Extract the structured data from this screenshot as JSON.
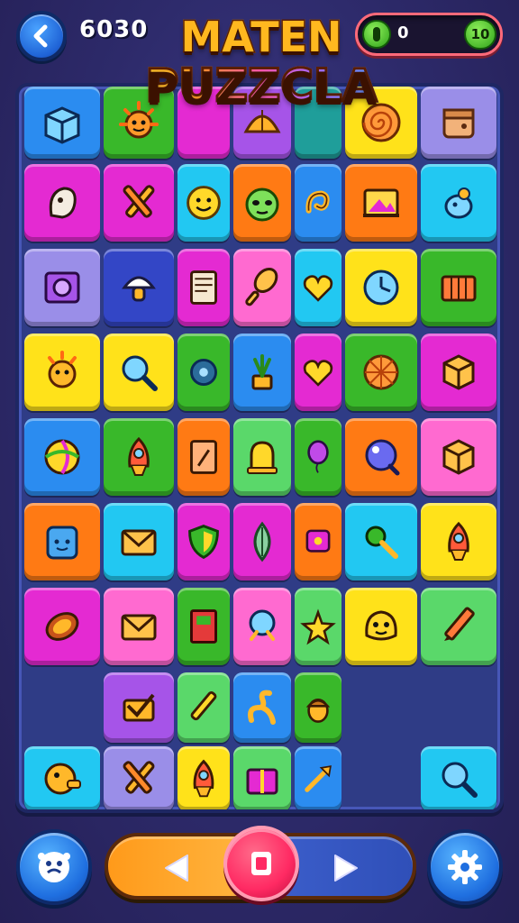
{
  "header": {
    "score": "6030",
    "title_line1": "MATEN",
    "title_line2": "PUZZCLA",
    "progress_current": "0",
    "progress_max": "10",
    "progress_fraction": 0
  },
  "colors": {
    "yellow": "#ffe21a",
    "cyan": "#22c8f2",
    "magenta": "#e42ad2",
    "purple": "#a654e8",
    "green": "#39b82a",
    "lime": "#5ad86a",
    "orange": "#ff7a14",
    "pink": "#ff6ad0",
    "blue": "#2b8cf0",
    "navy": "#3346c6",
    "teal": "#1f9e9a",
    "lavender": "#9a8ee8",
    "red": "#ef4a20"
  },
  "board": {
    "rows": [
      [
        {
          "icon": "cube-icon",
          "color": "blue"
        },
        {
          "icon": "sun-creature-icon",
          "color": "green"
        },
        {
          "icon": "blank",
          "color": "magenta"
        },
        {
          "icon": "shell-icon",
          "color": "purple"
        },
        {
          "icon": "blank",
          "color": "teal"
        },
        {
          "icon": "spiral-icon",
          "color": "yellow"
        },
        {
          "icon": "box-icon",
          "color": "lavender"
        }
      ],
      [
        {
          "icon": "ghost-icon",
          "color": "magenta"
        },
        {
          "icon": "crossed-tools-icon",
          "color": "magenta"
        },
        {
          "icon": "smiley-icon",
          "color": "cyan"
        },
        {
          "icon": "alien-icon",
          "color": "orange"
        },
        {
          "icon": "curl-icon",
          "color": "blue"
        },
        {
          "icon": "picture-icon",
          "color": "orange"
        },
        {
          "icon": "bird-icon",
          "color": "cyan"
        }
      ],
      [
        {
          "icon": "speaker-box-icon",
          "color": "lavender"
        },
        {
          "icon": "mushroom-icon",
          "color": "navy"
        },
        {
          "icon": "note-icon",
          "color": "magenta"
        },
        {
          "icon": "paddle-icon",
          "color": "pink"
        },
        {
          "icon": "heart-icon",
          "color": "cyan"
        },
        {
          "icon": "clock-icon",
          "color": "yellow"
        },
        {
          "icon": "crate-icon",
          "color": "green"
        }
      ],
      [
        {
          "icon": "sun-face-icon",
          "color": "yellow"
        },
        {
          "icon": "magnifier-icon",
          "color": "yellow"
        },
        {
          "icon": "gear-icon",
          "color": "green"
        },
        {
          "icon": "plant-icon",
          "color": "blue"
        },
        {
          "icon": "heart-icon",
          "color": "magenta"
        },
        {
          "icon": "shell-ball-icon",
          "color": "green"
        },
        {
          "icon": "block-icon",
          "color": "magenta"
        }
      ],
      [
        {
          "icon": "candy-icon",
          "color": "blue"
        },
        {
          "icon": "rocket-icon",
          "color": "green"
        },
        {
          "icon": "card-icon",
          "color": "orange"
        },
        {
          "icon": "bell-icon",
          "color": "lime"
        },
        {
          "icon": "balloon-icon",
          "color": "green"
        },
        {
          "icon": "bubble-icon",
          "color": "orange"
        },
        {
          "icon": "block-icon",
          "color": "pink"
        }
      ],
      [
        {
          "icon": "backpack-icon",
          "color": "orange"
        },
        {
          "icon": "envelope-icon",
          "color": "cyan"
        },
        {
          "icon": "shield-icon",
          "color": "magenta"
        },
        {
          "icon": "leaf-icon",
          "color": "magenta"
        },
        {
          "icon": "tag-icon",
          "color": "orange"
        },
        {
          "icon": "key-icon",
          "color": "cyan"
        },
        {
          "icon": "rocket-icon",
          "color": "yellow"
        }
      ],
      [
        {
          "icon": "coconut-icon",
          "color": "magenta"
        },
        {
          "icon": "envelope-icon",
          "color": "pink"
        },
        {
          "icon": "book-icon",
          "color": "green"
        },
        {
          "icon": "orb-icon",
          "color": "pink"
        },
        {
          "icon": "star-icon",
          "color": "lime"
        },
        {
          "icon": "blob-face-icon",
          "color": "yellow"
        },
        {
          "icon": "pencil-icon",
          "color": "lime"
        }
      ],
      [
        null,
        {
          "icon": "check-icon",
          "color": "purple"
        },
        {
          "icon": "brush-icon",
          "color": "lime"
        },
        {
          "icon": "squiggle-icon",
          "color": "blue"
        },
        {
          "icon": "acorn-icon",
          "color": "green"
        },
        null,
        null
      ],
      [
        {
          "icon": "fish-icon",
          "color": "cyan"
        },
        {
          "icon": "crossed-tools-icon",
          "color": "lavender"
        },
        {
          "icon": "rocket-icon",
          "color": "yellow"
        },
        {
          "icon": "gift-icon",
          "color": "lime"
        },
        {
          "icon": "arrow-icon",
          "color": "blue"
        },
        null,
        {
          "icon": "magnifier-icon",
          "color": "cyan"
        }
      ]
    ]
  },
  "footer": {
    "hint_icon": "face-icon",
    "prev_icon": "triangle-left-icon",
    "center_icon": "square-icon",
    "next_icon": "triangle-right-icon",
    "settings_icon": "gear-icon"
  }
}
